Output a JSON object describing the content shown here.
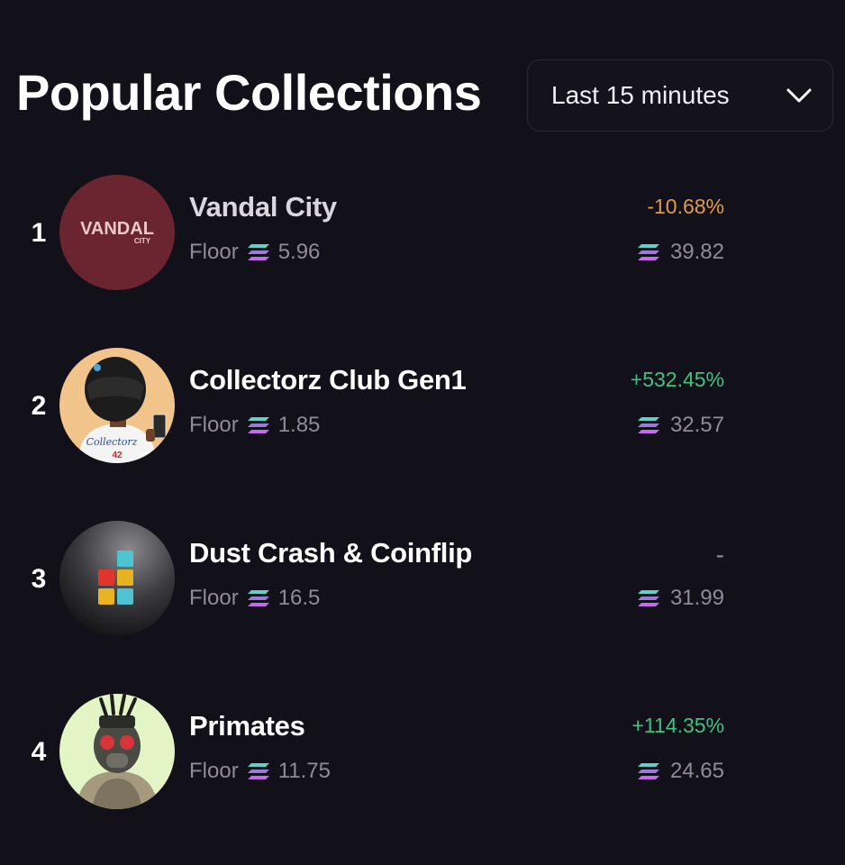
{
  "header": {
    "title": "Popular Collections",
    "timeframe": "Last 15 minutes"
  },
  "floor_label": "Floor",
  "collections": [
    {
      "rank": "1",
      "name": "Vandal City",
      "floor": "5.96",
      "change": "-10.68%",
      "volume": "39.82",
      "avatar_text": "VANDAL",
      "avatar_subtext": "CITY"
    },
    {
      "rank": "2",
      "name": "Collectorz Club Gen1",
      "floor": "1.85",
      "change": "+532.45%",
      "volume": "32.57",
      "avatar_text": "Collectorz",
      "avatar_subtext": "42"
    },
    {
      "rank": "3",
      "name": "Dust Crash & Coinflip",
      "floor": "16.5",
      "change": "-",
      "volume": "31.99"
    },
    {
      "rank": "4",
      "name": "Primates",
      "floor": "11.75",
      "change": "+114.35%",
      "volume": "24.65"
    }
  ],
  "colors": {
    "background": "#121019",
    "negative": "#e39a45",
    "positive": "#3fc47f",
    "muted": "#8f8b9a",
    "vandal_bg": "#6b2530"
  },
  "icons": {
    "currency": "solana-icon",
    "dropdown": "chevron-down-icon"
  }
}
